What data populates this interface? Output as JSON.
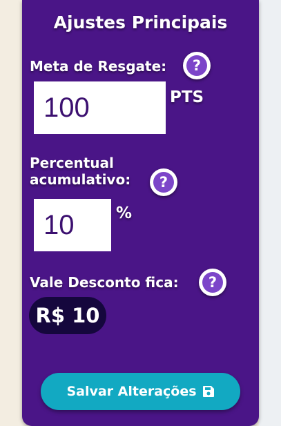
{
  "settings": {
    "title": "Ajustes Principais",
    "redemption_goal": {
      "label": "Meta de Resgate:",
      "value": "100",
      "unit": "PTS",
      "help": "?"
    },
    "cumulative_percent": {
      "label_line1": "Percentual",
      "label_line2": "acumulativo:",
      "value": "10",
      "unit": "%",
      "help": "?"
    },
    "discount_voucher": {
      "label": "Vale Desconto fica:",
      "value": "R$ 10",
      "help": "?"
    },
    "save_button": {
      "label": "Salvar Alterações",
      "icon": "save-icon"
    }
  },
  "colors": {
    "panel": "#4a1587",
    "help_inner": "#7c45c9",
    "voucher_pill": "#15073d",
    "save_button": "#12a9c2",
    "input_text": "#3c1070"
  }
}
